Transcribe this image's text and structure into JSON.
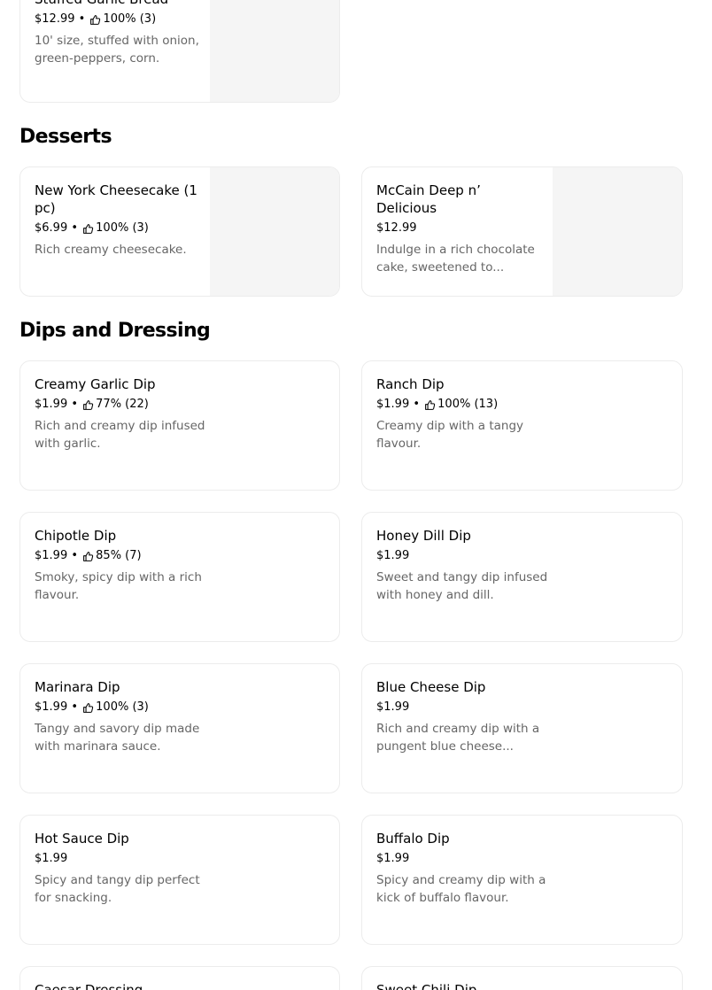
{
  "top_card": {
    "name": "Stuffed Garlic Bread",
    "price": "$12.99",
    "rating": "100% (3)",
    "description": "10' size, stuffed with onion, green-peppers, corn."
  },
  "sections": [
    {
      "title": "Desserts",
      "items": [
        {
          "name": "New York Cheesecake (1 pc)",
          "price": "$6.99",
          "rating": "100% (3)",
          "description": "Rich creamy cheesecake."
        },
        {
          "name": "McCain Deep n’ Delicious",
          "price": "$12.99",
          "rating": "",
          "description": "Indulge in a rich chocolate cake, sweetened to..."
        }
      ]
    },
    {
      "title": "Dips and Dressing",
      "items": [
        {
          "name": "Creamy Garlic Dip",
          "price": "$1.99",
          "rating": "77% (22)",
          "description": "Rich and creamy dip infused with garlic."
        },
        {
          "name": "Ranch Dip",
          "price": "$1.99",
          "rating": "100% (13)",
          "description": "Creamy dip with a tangy flavour."
        },
        {
          "name": "Chipotle Dip",
          "price": "$1.99",
          "rating": "85% (7)",
          "description": "Smoky, spicy dip with a rich flavour."
        },
        {
          "name": "Honey Dill Dip",
          "price": "$1.99",
          "rating": "",
          "description": "Sweet and tangy dip infused with honey and dill."
        },
        {
          "name": "Marinara Dip",
          "price": "$1.99",
          "rating": "100% (3)",
          "description": "Tangy and savory dip made with marinara sauce."
        },
        {
          "name": "Blue Cheese Dip",
          "price": "$1.99",
          "rating": "",
          "description": "Rich and creamy dip with a pungent blue cheese..."
        },
        {
          "name": "Hot Sauce Dip",
          "price": "$1.99",
          "rating": "",
          "description": "Spicy and tangy dip perfect for snacking."
        },
        {
          "name": "Buffalo Dip",
          "price": "$1.99",
          "rating": "",
          "description": "Spicy and creamy dip with a kick of buffalo flavour."
        },
        {
          "name": "Caesar Dressing",
          "price": "",
          "rating": "",
          "description": ""
        },
        {
          "name": "Sweet Chili Dip",
          "price": "",
          "rating": "",
          "description": ""
        }
      ]
    }
  ]
}
